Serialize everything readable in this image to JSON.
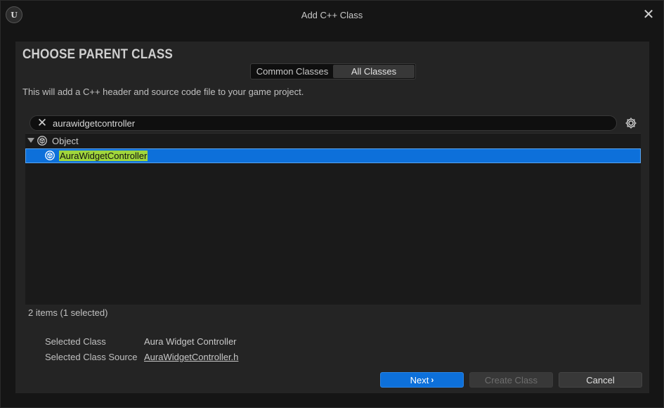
{
  "window": {
    "title": "Add C++ Class"
  },
  "header": {
    "heading": "CHOOSE PARENT CLASS",
    "description": "This will add a C++ header and source code file to your game project."
  },
  "tabs": [
    {
      "label": "Common Classes",
      "active": false
    },
    {
      "label": "All Classes",
      "active": true
    }
  ],
  "search": {
    "value": "aurawidgetcontroller",
    "placeholder": ""
  },
  "tree": {
    "items": [
      {
        "label": "Object",
        "expanded": true,
        "selected": false
      },
      {
        "label": "AuraWidgetController",
        "selected": true,
        "highlight": "AuraWidgetController"
      }
    ]
  },
  "status": {
    "count_text": "2 items (1 selected)"
  },
  "details": {
    "selected_class_label": "Selected Class",
    "selected_class_value": "Aura Widget Controller",
    "selected_source_label": "Selected Class Source",
    "selected_source_value": "AuraWidgetController.h"
  },
  "buttons": {
    "next": "Next",
    "create": "Create Class",
    "cancel": "Cancel"
  },
  "colors": {
    "accent": "#0d70da",
    "highlight": "#a0d63c",
    "panel": "#242424",
    "background": "#151515"
  }
}
